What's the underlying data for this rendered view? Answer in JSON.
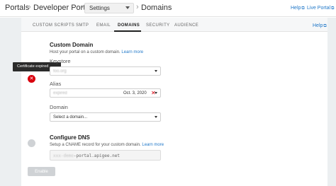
{
  "breadcrumb": {
    "portals": "Portals",
    "developer_portal": "Developer Portal",
    "settings_select": "Settings",
    "domains": "Domains",
    "separator": "›"
  },
  "top_links": {
    "help": "Help",
    "live_portal": "Live Portal",
    "external_icon": "external-link-icon"
  },
  "tabs": [
    {
      "label": "CUSTOM SCRIPTS",
      "active": false
    },
    {
      "label": "SMTP",
      "active": false
    },
    {
      "label": "EMAIL",
      "active": false
    },
    {
      "label": "DOMAINS",
      "active": true
    },
    {
      "label": "SECURITY",
      "active": false
    },
    {
      "label": "AUDIENCE",
      "active": false
    }
  ],
  "panel_help": "Help",
  "custom_domain": {
    "title": "Custom Domain",
    "description": "Host your portal on a custom domain.",
    "learn_more": "Learn more",
    "tooltip": "Certificate expired",
    "status_icon": "error-x-icon",
    "keystore_label": "Keystore",
    "keystore_value": "foo.org",
    "alias_label": "Alias",
    "alias_value": "expired",
    "alias_date": "Oct. 3, 2020",
    "alias_clear": "✕",
    "domain_label": "Domain",
    "domain_placeholder": "Select a domain..."
  },
  "configure_dns": {
    "title": "Configure DNS",
    "description": "Setup a CNAME record for your custom domain.",
    "learn_more": "Learn more",
    "cname_prefix": "xxx-demo",
    "cname_suffix": "-portal.apigee.net"
  },
  "enable_button": "Enable",
  "colors": {
    "link": "#1f77c8",
    "error": "#d9000d",
    "sidebar_gray": "#eceff1"
  }
}
